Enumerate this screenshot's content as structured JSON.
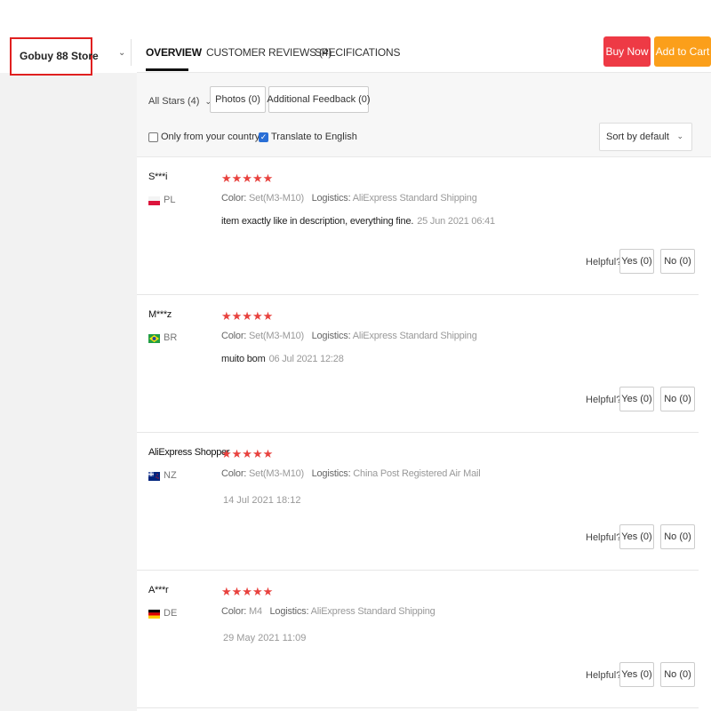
{
  "store": {
    "name": "Gobuy 88 Store"
  },
  "tabs": [
    {
      "label": "OVERVIEW",
      "active": true
    },
    {
      "label": "CUSTOMER REVIEWS (4)",
      "active": false
    },
    {
      "label": "SPECIFICATIONS",
      "active": false
    }
  ],
  "actions": {
    "buy_now": "Buy Now",
    "add_to_cart": "Add to Cart"
  },
  "filters": {
    "all_stars": "All Stars (4)",
    "photos": "Photos (0)",
    "additional_feedback": "Additional Feedback (0)",
    "only_country": "Only from your country",
    "only_country_checked": false,
    "translate": "Translate to English",
    "translate_checked": true,
    "sort": "Sort by default"
  },
  "colors": {
    "buy_now": "#ee3a45",
    "add_to_cart": "#fb9f1a",
    "stars": "#e8423e",
    "highlight_box": "#e02020"
  },
  "reviews": [
    {
      "name": "S***i",
      "country": "PL",
      "flag": "poland-flag",
      "stars": "★★★★★",
      "color_label": "Color:",
      "color": "Set(M3-M10)",
      "logistics_label": "Logistics:",
      "logistics": "AliExpress Standard Shipping",
      "text": "item exactly like in description, everything fine.",
      "date": "25 Jun 2021 06:41",
      "helpful": "Helpful?",
      "yes": "Yes (0)",
      "no": "No (0)"
    },
    {
      "name": "M***z",
      "country": "BR",
      "flag": "brazil-flag",
      "stars": "★★★★★",
      "color_label": "Color:",
      "color": "Set(M3-M10)",
      "logistics_label": "Logistics:",
      "logistics": "AliExpress Standard Shipping",
      "text": "muito bom",
      "date": "06 Jul 2021 12:28",
      "helpful": "Helpful?",
      "yes": "Yes (0)",
      "no": "No (0)"
    },
    {
      "name": "AliExpress Shopper",
      "country": "NZ",
      "flag": "new-zealand-flag",
      "stars": "★★★★★",
      "color_label": "Color:",
      "color": "Set(M3-M10)",
      "logistics_label": "Logistics:",
      "logistics": "China Post Registered Air Mail",
      "text": "",
      "date": "14 Jul 2021 18:12",
      "helpful": "Helpful?",
      "yes": "Yes (0)",
      "no": "No (0)"
    },
    {
      "name": "A***r",
      "country": "DE",
      "flag": "germany-flag",
      "stars": "★★★★★",
      "color_label": "Color:",
      "color": "M4",
      "logistics_label": "Logistics:",
      "logistics": "AliExpress Standard Shipping",
      "text": "",
      "date": "29 May 2021 11:09",
      "helpful": "Helpful?",
      "yes": "Yes (0)",
      "no": "No (0)"
    }
  ]
}
